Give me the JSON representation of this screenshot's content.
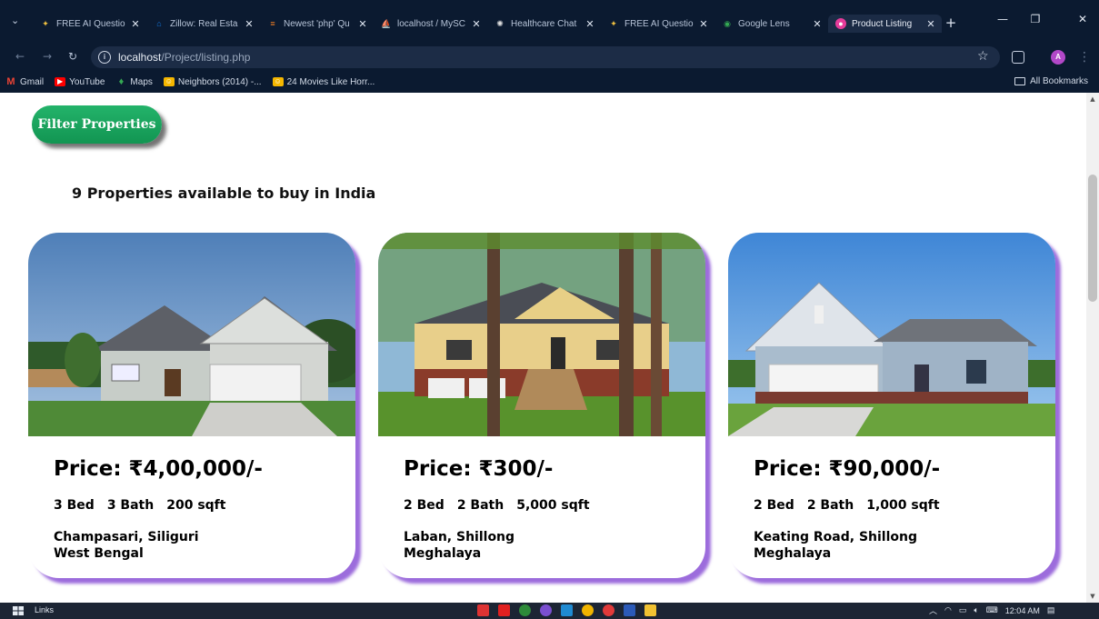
{
  "browser": {
    "tabs": [
      {
        "label": "FREE AI Questio",
        "icon": "ai-logo-icon",
        "color": "#f0c040",
        "active": false
      },
      {
        "label": "Zillow: Real Esta",
        "icon": "zillow-icon",
        "color": "#1277e1",
        "active": false
      },
      {
        "label": "Newest 'php' Qu",
        "icon": "stackoverflow-icon",
        "color": "#f48024",
        "active": false
      },
      {
        "label": "localhost / MySC",
        "icon": "phpmyadmin-icon",
        "color": "#f29111",
        "active": false
      },
      {
        "label": "Healthcare Chat",
        "icon": "chatgpt-icon",
        "color": "#e0e0e0",
        "active": false
      },
      {
        "label": "FREE AI Questio",
        "icon": "ai-logo-icon",
        "color": "#f0c040",
        "active": false
      },
      {
        "label": "Google Lens",
        "icon": "google-lens-icon",
        "color": "#34a853",
        "active": false
      },
      {
        "label": "Product Listing",
        "icon": "product-listing-icon",
        "color": "#e53b9a",
        "active": true
      }
    ],
    "url_host": "localhost",
    "url_path": "/Project/listing.php",
    "avatar_letter": "A",
    "bookmarks": [
      {
        "label": "Gmail",
        "icon": "gmail-icon",
        "color": "#ea4335"
      },
      {
        "label": "YouTube",
        "icon": "youtube-icon",
        "color": "#ff0000"
      },
      {
        "label": "Maps",
        "icon": "maps-icon",
        "color": "#34a853"
      },
      {
        "label": "Neighbors (2014) -...",
        "icon": "bookmark-site-icon",
        "color": "#f5b700"
      },
      {
        "label": "24 Movies Like Horr...",
        "icon": "bookmark-site-icon",
        "color": "#f5b700"
      }
    ],
    "all_bookmarks": "All Bookmarks"
  },
  "page": {
    "filter_button": "Filter Properties",
    "heading": "9 Properties available to buy in India",
    "accent_shadow": "#8b52d6",
    "filter_color": "#1aa35e",
    "listings": [
      {
        "price": "Price: ₹4,00,000/-",
        "beds": "3 Bed",
        "baths": "3 Bath",
        "area": "200 sqft",
        "locality": "Champasari, Siliguri",
        "state": "West Bengal"
      },
      {
        "price": "Price: ₹300/-",
        "beds": "2 Bed",
        "baths": "2 Bath",
        "area": "5,000 sqft",
        "locality": "Laban, Shillong",
        "state": "Meghalaya"
      },
      {
        "price": "Price: ₹90,000/-",
        "beds": "2 Bed",
        "baths": "2 Bath",
        "area": "1,000 sqft",
        "locality": "Keating Road, Shillong",
        "state": "Meghalaya"
      }
    ]
  },
  "taskbar": {
    "links": "Links",
    "time": "12:04 AM"
  }
}
